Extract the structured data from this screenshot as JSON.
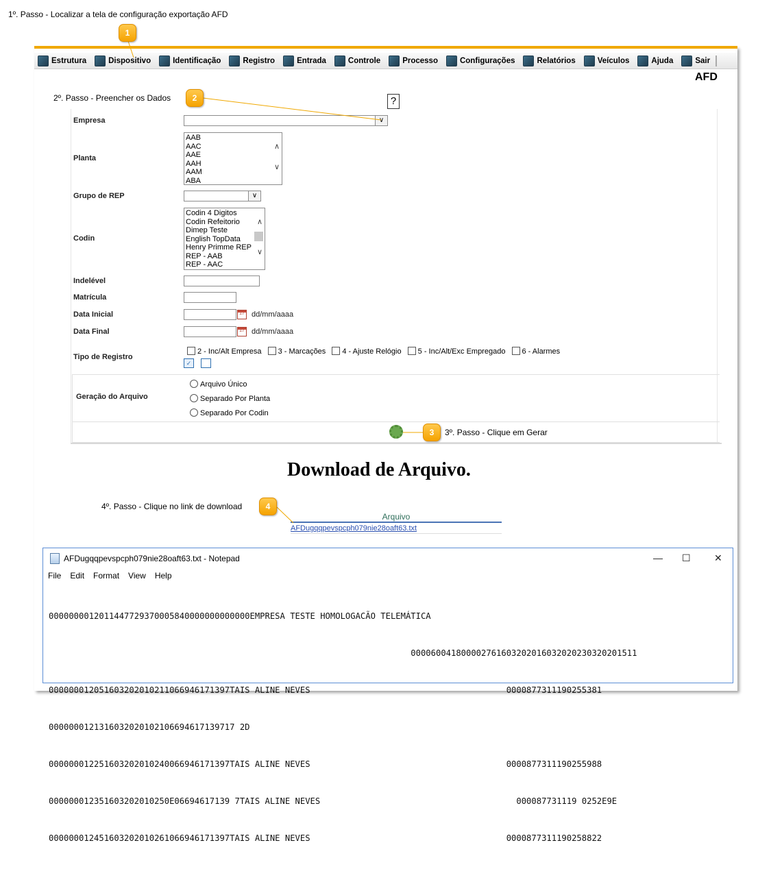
{
  "steps": {
    "step1": "1º. Passo - Localizar a tela de configuração exportação AFD",
    "step2": "2º. Passo - Preencher os Dados",
    "step3": "3º. Passo - Clique em Gerar",
    "step4": "4º. Passo - Clique no link de download"
  },
  "callouts": [
    "1",
    "2",
    "3",
    "4"
  ],
  "menu": [
    {
      "label": "Estrutura",
      "icon": "structure-icon"
    },
    {
      "label": "Dispositivo",
      "icon": "device-icon"
    },
    {
      "label": "Identificação",
      "icon": "identification-icon"
    },
    {
      "label": "Registro",
      "icon": "register-icon"
    },
    {
      "label": "Entrada",
      "icon": "entry-icon"
    },
    {
      "label": "Controle",
      "icon": "control-icon"
    },
    {
      "label": "Processo",
      "icon": "process-icon"
    },
    {
      "label": "Configurações",
      "icon": "settings-icon"
    },
    {
      "label": "Relatórios",
      "icon": "reports-icon"
    },
    {
      "label": "Veículos",
      "icon": "vehicles-icon"
    },
    {
      "label": "Ajuda",
      "icon": "help-icon"
    },
    {
      "label": "Sair",
      "icon": "exit-icon"
    }
  ],
  "page_title": "AFD",
  "form": {
    "empresa_label": "Empresa",
    "empresa_value": "",
    "planta_label": "Planta",
    "planta_options": [
      "AAB",
      "AAC",
      "AAE",
      "AAH",
      "AAM",
      "ABA"
    ],
    "grupo_label": "Grupo de REP",
    "grupo_value": "",
    "codin_label": "Codin",
    "codin_options": [
      "Codin 4 Digitos",
      "Codin Refeitorio",
      "Dimep Teste",
      "English TopData",
      "Henry Primme REP",
      "REP - AAB",
      "REP - AAC"
    ],
    "indelevel_label": "Indelével",
    "matricula_label": "Matrícula",
    "data_inicial_label": "Data Inicial",
    "data_final_label": "Data Final",
    "date_hint": "dd/mm/aaaa",
    "tipo_label": "Tipo de Registro",
    "tipo_options": [
      "2 - Inc/Alt Empresa",
      "3 - Marcações",
      "4 - Ajuste Relógio",
      "5 - Inc/Alt/Exc Empregado",
      "6 - Alarmes"
    ],
    "geracao_label": "Geração do Arquivo",
    "geracao_options": [
      "Arquivo Único",
      "Separado Por Planta",
      "Separado Por Codin"
    ]
  },
  "download": {
    "title": "Download de Arquivo.",
    "column_header": "Arquivo",
    "link_text": "AFDugqqpevspcph079nie28oaft63.txt"
  },
  "notepad": {
    "title": "AFDugqqpevspcph079nie28oaft63.txt - Notepad",
    "menu": [
      "File",
      "Edit",
      "Format",
      "View",
      "Help"
    ],
    "minimize": "—",
    "maximize": "☐",
    "close": "✕",
    "lines": [
      "0000000012011447729370005840000000000000EMPRESA TESTE HOMOLOGACÃO TELEMÁTICA",
      "                                                                        00006004180000276160320201603202023032020151​1",
      "000000012051603202010211066946171397TAIS ALINE NEVES                                       0000877311190255381",
      "0000000121316032020102106694617139717 2D",
      "000000012251603202010240066946171397TAIS ALINE NEVES                                       0000877311190255988",
      "000000012351603202010250E06694617139 7TAIS ALINE NEVES                                       000087731119 0252E9E",
      "000000012451603202010261066946171397TAIS ALINE NEVES                                       0000877311190258822"
    ]
  }
}
